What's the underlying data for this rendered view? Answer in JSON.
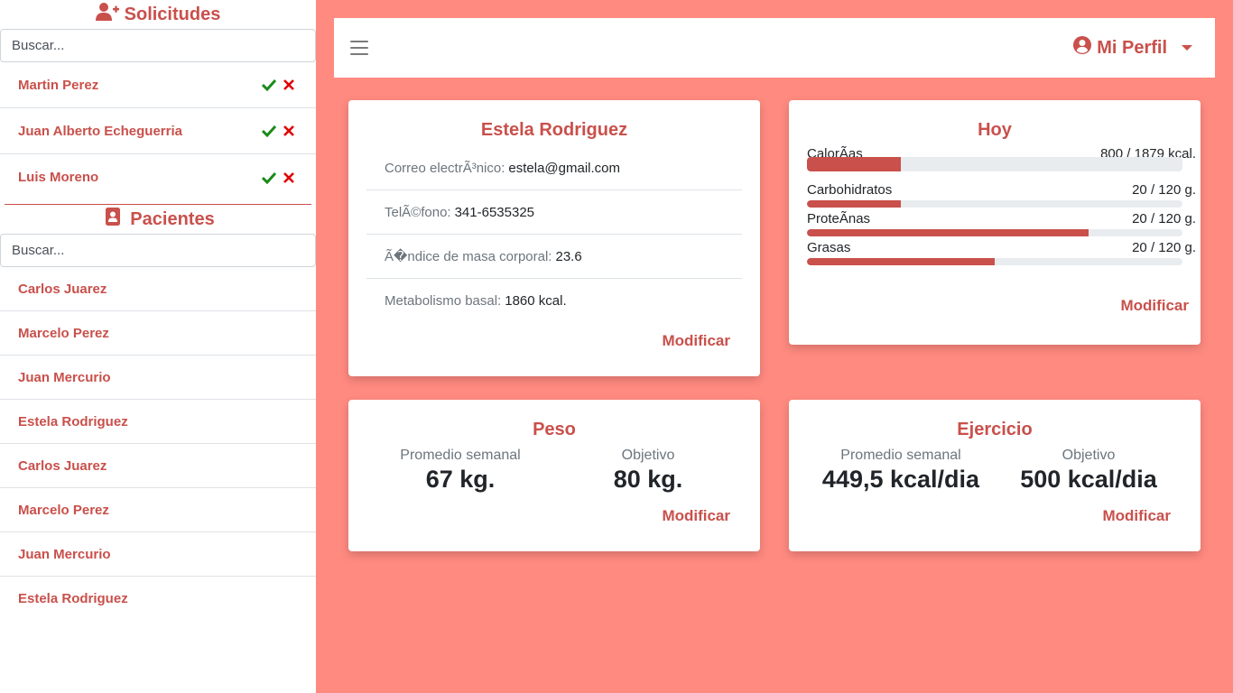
{
  "sidebar": {
    "requests_title": "Solicitudes",
    "requests_search_placeholder": "Buscar...",
    "requests": [
      {
        "name": "Martin Perez"
      },
      {
        "name": "Juan Alberto Echeguerria"
      },
      {
        "name": "Luis Moreno"
      }
    ],
    "patients_title": "Pacientes",
    "patients_search_placeholder": "Buscar...",
    "patients": [
      {
        "name": "Carlos Juarez"
      },
      {
        "name": "Marcelo Perez"
      },
      {
        "name": "Juan Mercurio"
      },
      {
        "name": "Estela Rodriguez"
      },
      {
        "name": "Carlos Juarez"
      },
      {
        "name": "Marcelo Perez"
      },
      {
        "name": "Juan Mercurio"
      },
      {
        "name": "Estela Rodriguez"
      }
    ]
  },
  "header": {
    "profile_label": "Mi Perfil"
  },
  "patient_card": {
    "name": "Estela Rodriguez",
    "email_label": "Correo electrÃ³nico:",
    "email": "estela@gmail.com",
    "phone_label": "TelÃ©fono:",
    "phone": "341-6535325",
    "bmi_label": "Ã�ndice de masa corporal:",
    "bmi": "23.6",
    "bmr_label": "Metabolismo basal:",
    "bmr": "1860 kcal.",
    "modify_label": "Modificar"
  },
  "today_card": {
    "title": "Hoy",
    "macros": [
      {
        "label": "CalorÃas",
        "value_text": "800 / 1879 kcal.",
        "fraction": 0.25
      },
      {
        "label": "Carbohidratos",
        "value_text": "20 / 120 g.",
        "fraction": 0.25
      },
      {
        "label": "ProteÃnas",
        "value_text": "20 / 120 g.",
        "fraction": 0.75
      },
      {
        "label": "Grasas",
        "value_text": "20 / 120 g.",
        "fraction": 0.5
      }
    ],
    "modify_label": "Modificar"
  },
  "weight_card": {
    "title": "Peso",
    "avg_label": "Promedio semanal",
    "avg_value": "67 kg.",
    "goal_label": "Objetivo",
    "goal_value": "80 kg.",
    "modify_label": "Modificar"
  },
  "exercise_card": {
    "title": "Ejercicio",
    "avg_label": "Promedio semanal",
    "avg_value": "449,5 kcal/dia",
    "goal_label": "Objetivo",
    "goal_value": "500 kcal/dia",
    "modify_label": "Modificar"
  },
  "colors": {
    "accent": "#c9504b",
    "background": "#ff8a80",
    "accept": "#1a8a1a",
    "reject": "#e00000"
  }
}
